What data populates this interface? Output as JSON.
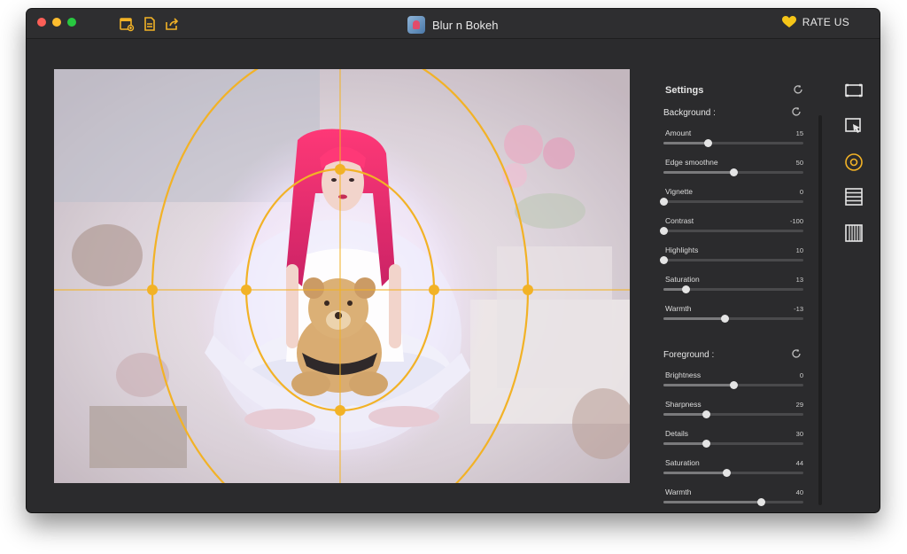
{
  "window": {
    "title": "Blur n Bokeh",
    "rate_label": "RATE US"
  },
  "toolbar_icons": [
    "open-image-icon",
    "document-icon",
    "share-export-icon"
  ],
  "settings": {
    "title": "Settings",
    "background": {
      "label": "Background :",
      "sliders": [
        {
          "name": "amount",
          "label": "Amount",
          "value": "15",
          "level": 0.32
        },
        {
          "name": "edge-smoothness",
          "label": "Edge smoothne",
          "value": "50",
          "level": 0.5
        },
        {
          "name": "vignette",
          "label": "Vignette",
          "value": "0",
          "level": 0.0
        },
        {
          "name": "contrast",
          "label": "Contrast",
          "value": "-100",
          "level": 0.0
        },
        {
          "name": "highlights",
          "label": "Highlights",
          "value": "10",
          "level": 0.0
        },
        {
          "name": "saturation",
          "label": "Saturation",
          "value": "13",
          "level": 0.16
        },
        {
          "name": "warmth",
          "label": "Warmth",
          "value": "-13",
          "level": 0.44
        }
      ]
    },
    "foreground": {
      "label": "Foreground :",
      "sliders": [
        {
          "name": "brightness",
          "label": "Brightness",
          "value": "0",
          "level": 0.5
        },
        {
          "name": "sharpness",
          "label": "Sharpness",
          "value": "29",
          "level": 0.31
        },
        {
          "name": "details",
          "label": "Details",
          "value": "30",
          "level": 0.31
        },
        {
          "name": "saturation",
          "label": "Saturation",
          "value": "44",
          "level": 0.45
        },
        {
          "name": "warmth",
          "label": "Warmth",
          "value": "40",
          "level": 0.7
        }
      ]
    }
  },
  "side_tools": [
    "crop-icon",
    "select-region-icon",
    "radial-focus-icon",
    "linear-stripes-icon",
    "vertical-stripes-icon"
  ],
  "colors": {
    "accent": "#f2b226",
    "heart": "#f5c518",
    "window_bg": "#2b2b2d"
  }
}
